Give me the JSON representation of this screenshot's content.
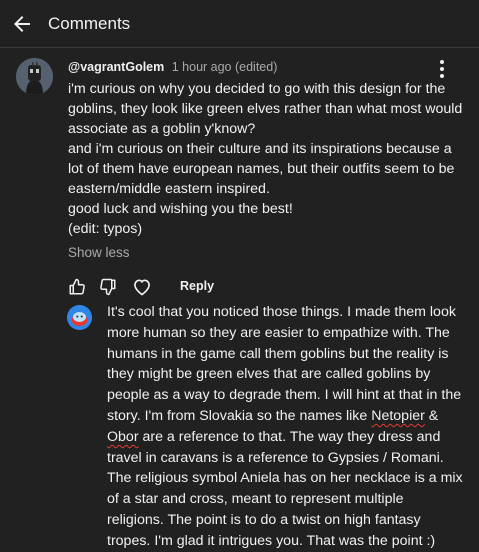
{
  "header": {
    "title": "Comments"
  },
  "comment": {
    "author": "@vagrantGolem",
    "meta": "1 hour ago (edited)",
    "lines": [
      "i'm curious on why you decided to go with this design for the",
      "goblins, they look like green elves rather than what most would",
      "associate as a goblin y'know?",
      "and i'm curious on their culture and its inspirations because a",
      "lot of them have european names, but their outfits seem to be",
      "eastern/middle eastern inspired.",
      "good luck and wishing you the best!",
      "(edit: typos)"
    ],
    "show_less": "Show less",
    "reply_label": "Reply"
  },
  "reply": {
    "lines": [
      "It's cool that you noticed those things. I made them look",
      "more human so they are easier to empathize with. The",
      "humans in the game call them goblins but the reality is",
      "they might be green elves that are called goblins by",
      "people as a way to degrade them. I will hint at that in the",
      "story. I'm from Slovakia so the names like ",
      "Netopier",
      " &",
      "Obor",
      " are a reference to that. The way they dress and",
      "travel in caravans is a reference to Gypsies / Romani.",
      "The religious symbol Aniela has on her necklace is a mix",
      "of a star and cross, meant to represent multiple",
      "religions. The point is to do a twist on high fantasy",
      "tropes. I'm glad it intrigues you. That was the point :)"
    ]
  },
  "colors": {
    "background": "#212121",
    "text": "#f1f1f1",
    "muted": "#aaaaaa",
    "spell_underline": "#e53935",
    "reply_avatar": "#2f86e6"
  },
  "icons": [
    "back-arrow-icon",
    "kebab-menu-icon",
    "thumbs-up-icon",
    "thumbs-down-icon",
    "heart-icon",
    "blob-avatar-icon"
  ]
}
